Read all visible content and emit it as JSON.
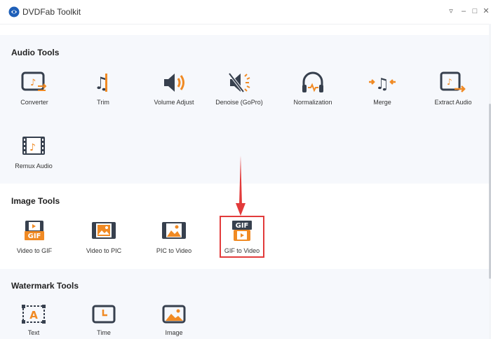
{
  "window": {
    "title": "DVDFab Toolkit",
    "controls": [
      "menu-icon",
      "minimize-icon",
      "maximize-icon",
      "close-icon"
    ]
  },
  "sections": {
    "audio": {
      "title": "Audio Tools",
      "tools": [
        {
          "label": "Converter",
          "icon": "converter-icon"
        },
        {
          "label": "Trim",
          "icon": "trim-icon"
        },
        {
          "label": "Volume Adjust",
          "icon": "volume-icon"
        },
        {
          "label": "Denoise (GoPro)",
          "icon": "denoise-icon"
        },
        {
          "label": "Normalization",
          "icon": "headphones-icon"
        },
        {
          "label": "Merge",
          "icon": "merge-icon"
        },
        {
          "label": "Extract Audio",
          "icon": "extract-audio-icon"
        },
        {
          "label": "Remux Audio",
          "icon": "remux-audio-icon"
        }
      ]
    },
    "image": {
      "title": "Image Tools",
      "tools": [
        {
          "label": "Video to GIF",
          "icon": "video-to-gif-icon",
          "badge": "GIF"
        },
        {
          "label": "Video to PIC",
          "icon": "video-to-pic-icon"
        },
        {
          "label": "PIC to Video",
          "icon": "pic-to-video-icon"
        },
        {
          "label": "GIF to Video",
          "icon": "gif-to-video-icon",
          "badge": "GIF",
          "highlighted": true
        }
      ]
    },
    "watermark": {
      "title": "Watermark Tools",
      "tools": [
        {
          "label": "Text",
          "icon": "text-watermark-icon",
          "glyph": "A"
        },
        {
          "label": "Time",
          "icon": "time-watermark-icon"
        },
        {
          "label": "Image",
          "icon": "image-watermark-icon"
        }
      ]
    }
  },
  "colors": {
    "accent": "#f08a24",
    "icon_dark": "#37404e",
    "highlight": "#e23b3b"
  }
}
